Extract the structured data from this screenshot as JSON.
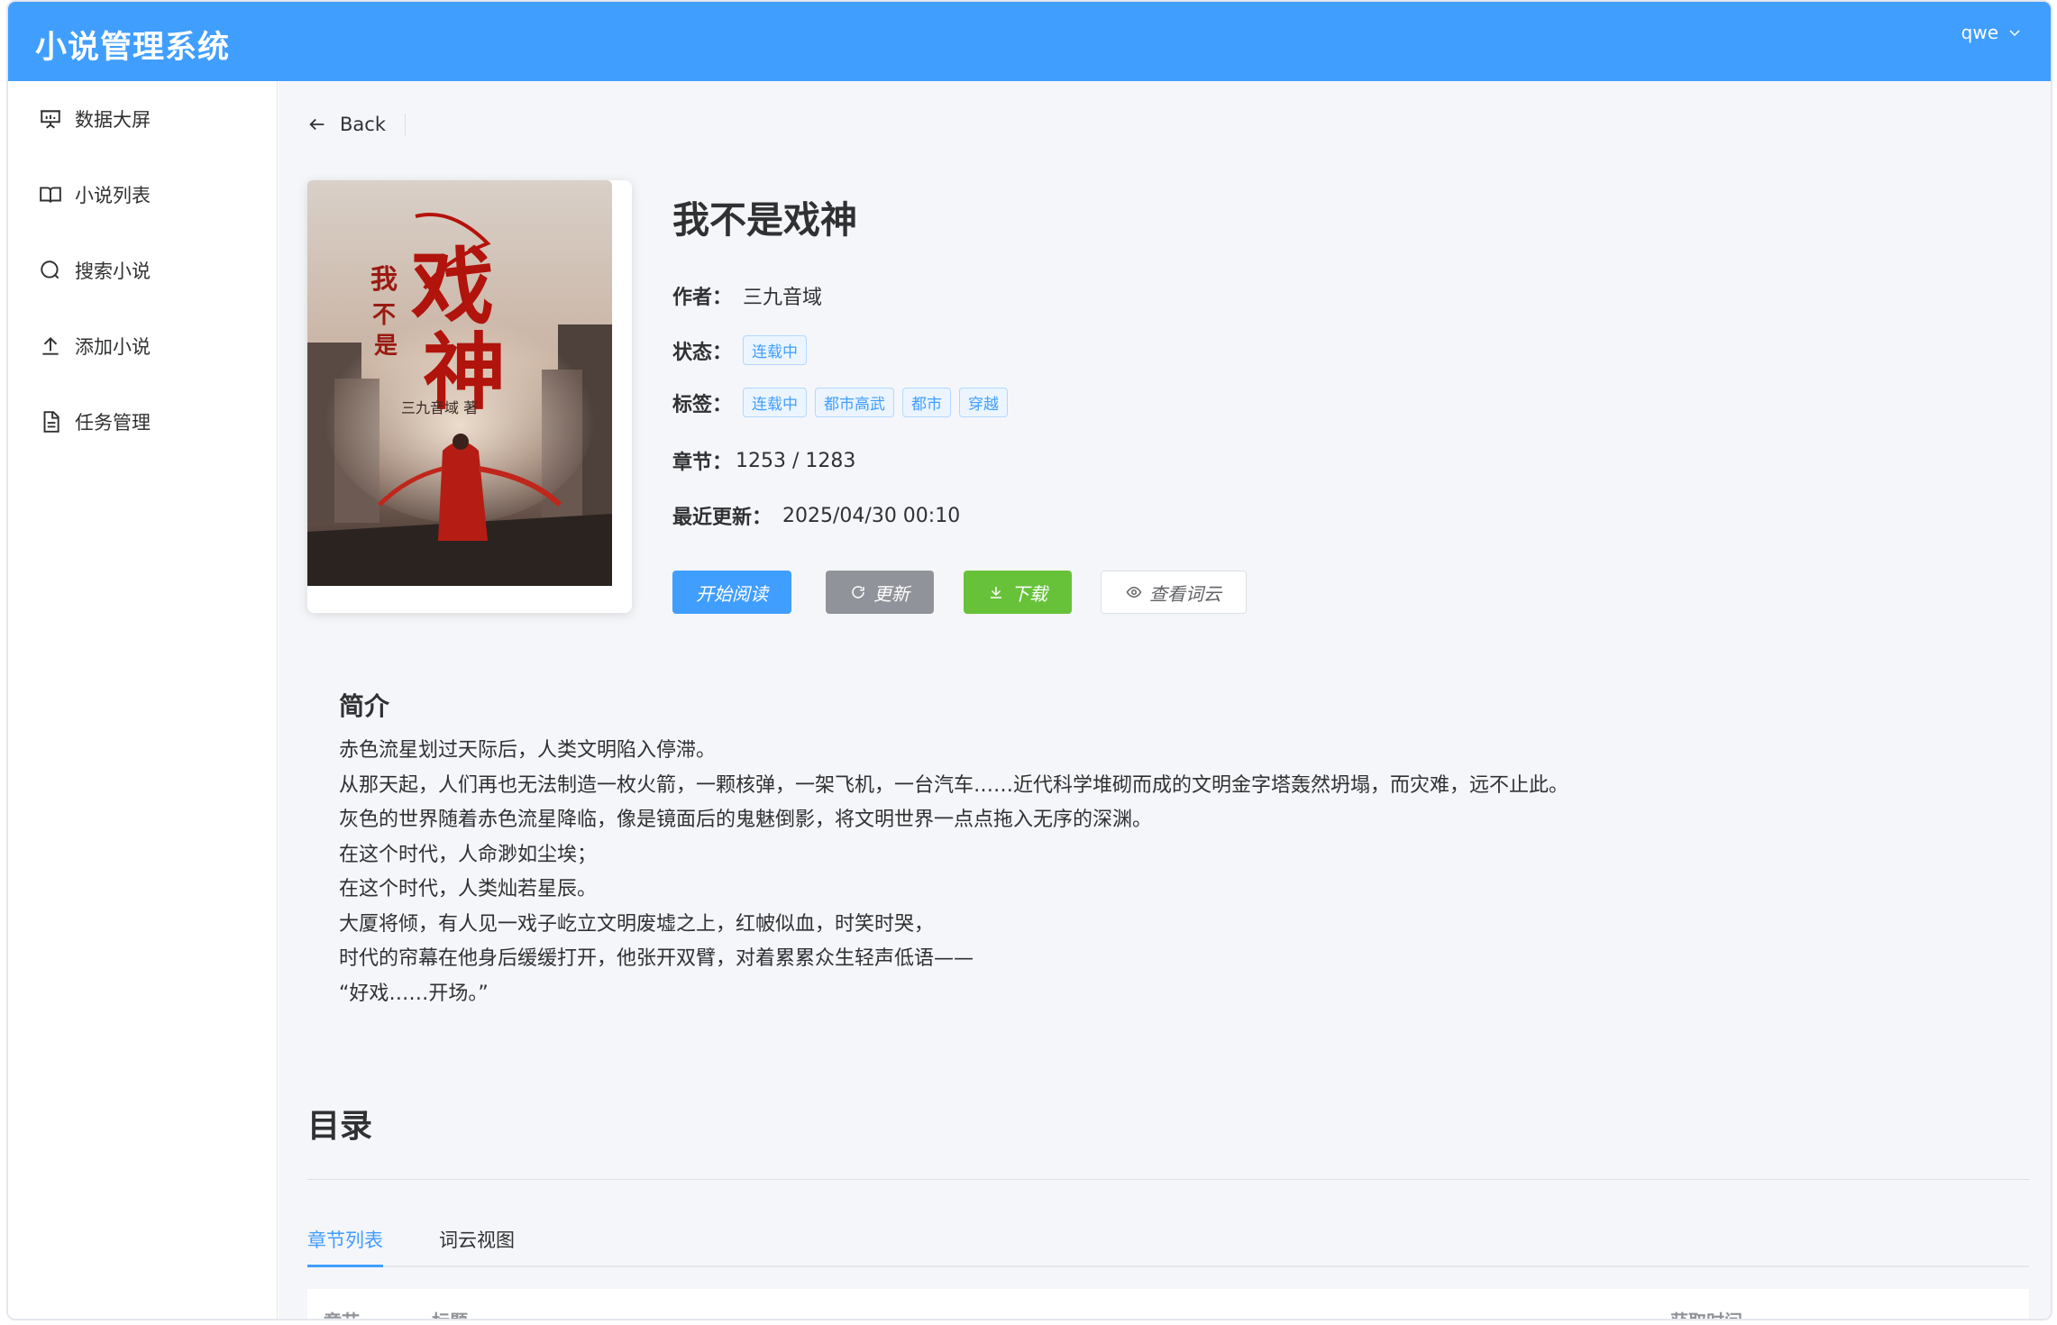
{
  "header": {
    "title": "小说管理系统",
    "user": "qwe"
  },
  "sidebar": {
    "items": [
      {
        "label": "数据大屏",
        "icon": "presentation-icon"
      },
      {
        "label": "小说列表",
        "icon": "book-icon"
      },
      {
        "label": "搜索小说",
        "icon": "search-icon"
      },
      {
        "label": "添加小说",
        "icon": "upload-icon"
      },
      {
        "label": "任务管理",
        "icon": "document-icon"
      }
    ]
  },
  "nav": {
    "back_label": "Back"
  },
  "book": {
    "title": "我不是戏神",
    "author_label": "作者：",
    "author": "三九音域",
    "status_label": "状态：",
    "status": "连载中",
    "tags_label": "标签：",
    "tags": [
      "连载中",
      "都市高武",
      "都市",
      "穿越"
    ],
    "chapters_label": "章节：",
    "chapters": "1253 / 1283",
    "updated_label": "最近更新：",
    "updated": "2025/04/30 00:10",
    "cover_title": "我不是戏神",
    "cover_author": "三九音域"
  },
  "actions": {
    "read": "开始阅读",
    "update": "更新",
    "download": "下载",
    "wordcloud": "查看词云"
  },
  "intro": {
    "heading": "简介",
    "lines": [
      "赤色流星划过天际后，人类文明陷入停滞。",
      "从那天起，人们再也无法制造一枚火箭，一颗核弹，一架飞机，一台汽车……近代科学堆砌而成的文明金字塔轰然坍塌，而灾难，远不止此。",
      "灰色的世界随着赤色流星降临，像是镜面后的鬼魅倒影，将文明世界一点点拖入无序的深渊。",
      "在这个时代，人命渺如尘埃；",
      "在这个时代，人类灿若星辰。",
      "大厦将倾，有人见一戏子屹立文明废墟之上，红帔似血，时笑时哭，",
      "时代的帘幕在他身后缓缓打开，他张开双臂，对着累累众生轻声低语——",
      "“好戏……开场。”"
    ]
  },
  "toc": {
    "heading": "目录",
    "tabs": [
      "章节列表",
      "词云视图"
    ],
    "columns": [
      "章节",
      "标题",
      "获取时间"
    ]
  },
  "colors": {
    "primary": "#409eff",
    "info": "#909399",
    "success": "#67c23a",
    "page_bg": "#f4f6f9"
  }
}
